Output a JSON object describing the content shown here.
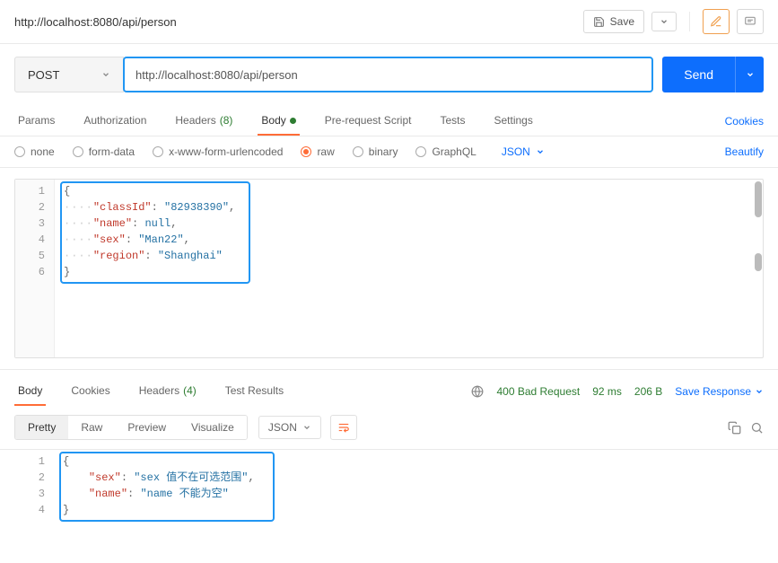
{
  "header": {
    "tab_title": "http://localhost:8080/api/person",
    "save_label": "Save"
  },
  "request": {
    "method": "POST",
    "url": "http://localhost:8080/api/person",
    "send_label": "Send"
  },
  "req_tabs": {
    "params": "Params",
    "authorization": "Authorization",
    "headers": "Headers",
    "headers_count": "(8)",
    "body": "Body",
    "prerequest": "Pre-request Script",
    "tests": "Tests",
    "settings": "Settings",
    "cookies": "Cookies"
  },
  "body_type": {
    "none": "none",
    "form_data": "form-data",
    "urlencoded": "x-www-form-urlencoded",
    "raw": "raw",
    "binary": "binary",
    "graphql": "GraphQL",
    "format": "JSON",
    "beautify": "Beautify"
  },
  "request_body_lines": [
    "1",
    "2",
    "3",
    "4",
    "5",
    "6"
  ],
  "chart_data": {
    "type": "table",
    "title": "Request JSON body",
    "data": {
      "classId": "82938390",
      "name": null,
      "sex": "Man22",
      "region": "Shanghai"
    }
  },
  "resp_tabs": {
    "body": "Body",
    "cookies": "Cookies",
    "headers": "Headers",
    "headers_count": "(4)",
    "test_results": "Test Results"
  },
  "resp_meta": {
    "status": "400 Bad Request",
    "time": "92 ms",
    "size": "206 B",
    "save_response": "Save Response"
  },
  "resp_toolbar": {
    "pretty": "Pretty",
    "raw": "Raw",
    "preview": "Preview",
    "visualize": "Visualize",
    "format": "JSON"
  },
  "response_body_lines": [
    "1",
    "2",
    "3",
    "4"
  ],
  "response_body": {
    "sex": "sex 值不在可选范围",
    "name": "name 不能为空"
  }
}
